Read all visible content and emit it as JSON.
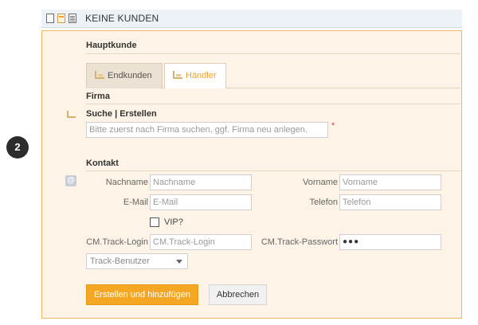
{
  "header": {
    "icons": [
      "document-icon",
      "document-orange-icon",
      "list-document-icon"
    ],
    "title": "KEINE KUNDEN"
  },
  "step_badge": "2",
  "hauptkunde": {
    "title": "Hauptkunde",
    "tabs": [
      {
        "label": "Endkunden",
        "active": false
      },
      {
        "label": "Händler",
        "active": true
      }
    ]
  },
  "firma": {
    "title": "Firma",
    "search_title": "Suche | Erstellen",
    "search_placeholder": "Bitte zuerst nach Firma suchen, ggf. Firma neu anlegen.",
    "required_marker": "*"
  },
  "kontakt": {
    "title": "Kontakt",
    "nachname": {
      "label": "Nachname",
      "placeholder": "Nachname"
    },
    "vorname": {
      "label": "Vorname",
      "placeholder": "Vorname"
    },
    "email": {
      "label": "E-Mail",
      "placeholder": "E-Mail"
    },
    "telefon": {
      "label": "Telefon",
      "placeholder": "Telefon"
    },
    "vip": {
      "label": "VIP?",
      "checked": false
    },
    "track_login": {
      "label": "CM.Track-Login",
      "placeholder": "CM.Track-Login"
    },
    "track_passwort": {
      "label": "CM.Track-Passwort",
      "value": "●●●"
    },
    "track_role_select": {
      "selected": "Track-Benutzer"
    }
  },
  "actions": {
    "create_label": "Erstellen und hinzufügen",
    "cancel_label": "Abbrechen"
  },
  "colors": {
    "accent": "#f5a623",
    "panel_bg": "#fdf3e6",
    "panel_border": "#f0b860",
    "header_bg": "#edf1f8",
    "required": "#e04040"
  }
}
